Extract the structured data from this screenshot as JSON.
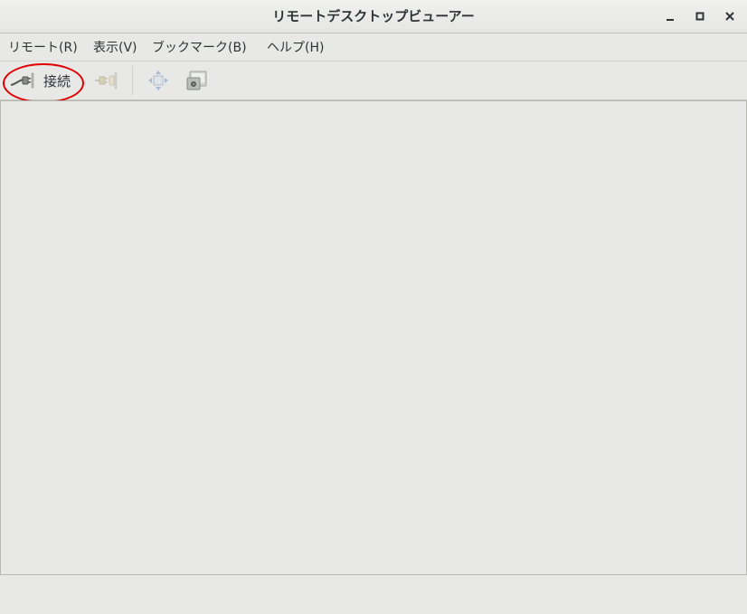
{
  "window": {
    "title": "リモートデスクトップビューアー",
    "controls": {
      "minimize": "–",
      "maximize": "□",
      "close": "✕"
    }
  },
  "menubar": {
    "items": [
      "リモート(R)",
      "表示(V)",
      "ブックマーク(B)",
      "ヘルプ(H)"
    ]
  },
  "toolbar": {
    "connect": {
      "label": "接続",
      "icon": "connect-plug-icon"
    },
    "disconnect": {
      "icon": "disconnect-plug-icon"
    },
    "fullscreen": {
      "icon": "fullscreen-icon"
    },
    "screenshot": {
      "icon": "screenshot-icon"
    }
  },
  "colors": {
    "highlight": "#e00000",
    "background": "#e8e8e7"
  }
}
